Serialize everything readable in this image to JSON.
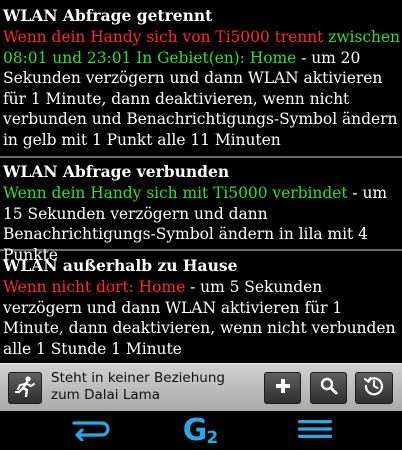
{
  "rules": [
    {
      "title": "WLAN Abfrage getrennt",
      "trigger": "Wenn dein Handy sich von Ti5000 trennt",
      "condition": "zwischen 08:01 und 23:01 In Gebiet(en): Home",
      "action": "- um 20 Sekunden verzögern und dann WLAN aktivieren für 1 Minute, dann deaktivieren, wenn nicht verbunden und Benachrichtigungs-Symbol ändern in gelb mit 1 Punkt alle 11 Minuten"
    },
    {
      "title": "WLAN Abfrage verbunden",
      "trigger": "Wenn dein Handy sich mit Ti5000 verbindet",
      "action": "- um 15 Sekunden verzögern und dann Benachrichtigungs-Symbol ändern in lila mit 4 Punkte"
    },
    {
      "title": "WLAN außerhalb zu Hause",
      "trigger": "Wenn nicht dort: Home",
      "action": "- um 5 Sekunden verzögern und dann WLAN aktivieren für 1 Minute, dann deaktivieren, wenn nicht verbunden alle 1 Stunde 1 Minute"
    }
  ],
  "bottombar": {
    "status": "Steht in keiner Beziehung zum Dalai Lama",
    "icons": [
      "running-person-icon",
      "plus-icon",
      "search-icon",
      "history-icon"
    ]
  },
  "navbar": {
    "logo": "G",
    "logo_sub": "2",
    "icons": [
      "back-arrow-icon",
      "menu-icon"
    ]
  },
  "colors": {
    "trigger": "#ff2a2a",
    "condition": "#33dd33",
    "logo": "#2aa8e6",
    "divider": "#6a6a6a"
  }
}
